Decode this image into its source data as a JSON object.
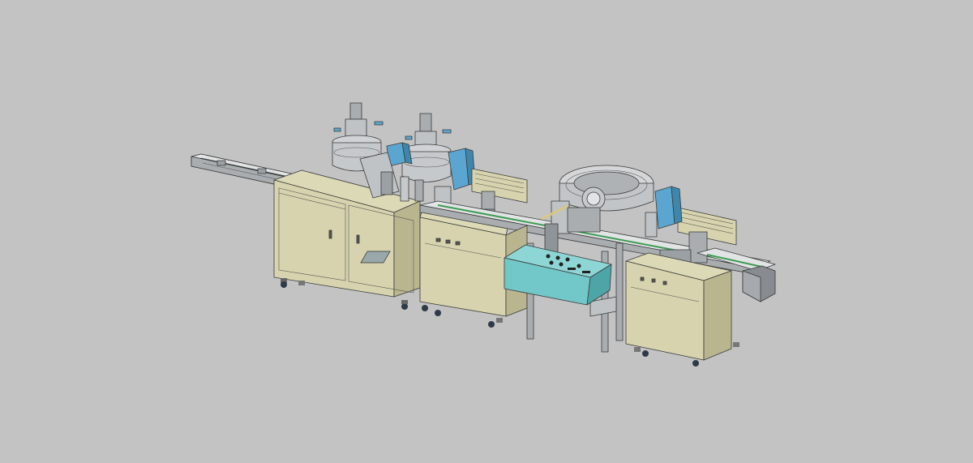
{
  "view": {
    "background": "#c3c3c3",
    "palette": {
      "cabinet": "#d6d3ae",
      "cabinet_dark": "#b9b68f",
      "metal": "#bfc3c6",
      "metal_dark": "#8f9498",
      "metal_light": "#e1e3e4",
      "blue_unit": "#5aa6d1",
      "panel": "#72c7c8",
      "panel_dark": "#4ea5a7",
      "belt": "#3c9b52"
    },
    "icons": {
      "caster": "caster-wheel-icon",
      "leveling_foot": "leveling-foot-icon",
      "handle": "door-handle-icon"
    }
  },
  "machine": {
    "modules": [
      "left-infeed-conveyor",
      "glue-tank-cabinet",
      "dispensing-station",
      "bowl-feeder-station",
      "control-panel",
      "right-cabinet-station",
      "outfeed-conveyor"
    ],
    "glue_tank_count": 2,
    "blue_units": 3
  }
}
